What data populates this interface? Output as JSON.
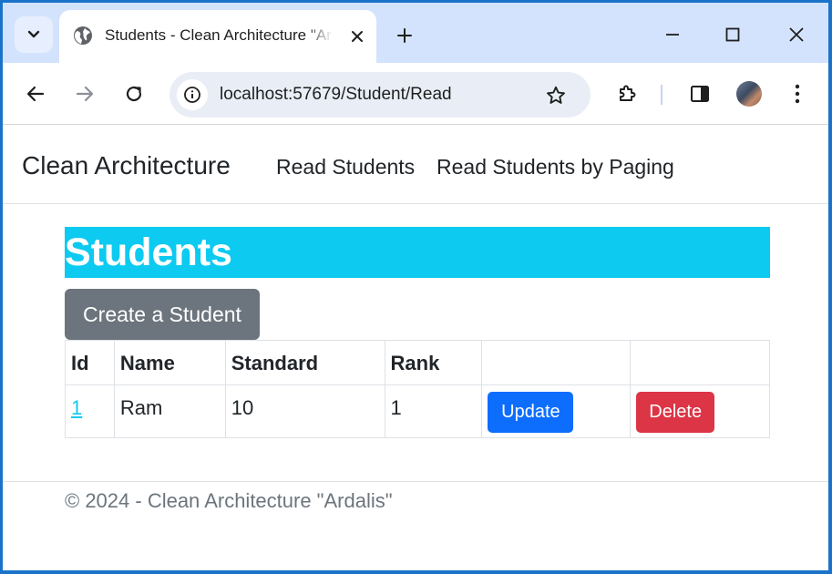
{
  "browser": {
    "tab_title": "Students - Clean Architecture \"Ardalis\"",
    "url": "localhost:57679/Student/Read",
    "icons": [
      "chevron-down-icon",
      "globe-icon",
      "close-icon",
      "plus-icon",
      "minimize-icon",
      "maximize-icon",
      "window-close-icon",
      "back-icon",
      "forward-icon",
      "reload-icon",
      "site-info-icon",
      "star-icon",
      "extensions-icon",
      "side-panel-icon",
      "menu-icon"
    ]
  },
  "navbar": {
    "brand": "Clean Architecture",
    "links": [
      "Read Students",
      "Read Students by Paging"
    ]
  },
  "main": {
    "heading": "Students",
    "create_button": "Create a Student",
    "table": {
      "headers": [
        "Id",
        "Name",
        "Standard",
        "Rank",
        "",
        ""
      ],
      "rows": [
        {
          "id": "1",
          "name": "Ram",
          "standard": "10",
          "rank": "1",
          "update_label": "Update",
          "delete_label": "Delete"
        }
      ]
    }
  },
  "footer": {
    "text": "© 2024 - Clean Architecture \"Ardalis\""
  },
  "colors": {
    "heading_bg": "#0dcaf0",
    "create_button": "#6c757d",
    "update_button": "#0d6efd",
    "delete_button": "#dc3545",
    "tabstrip": "#d3e3fd"
  }
}
